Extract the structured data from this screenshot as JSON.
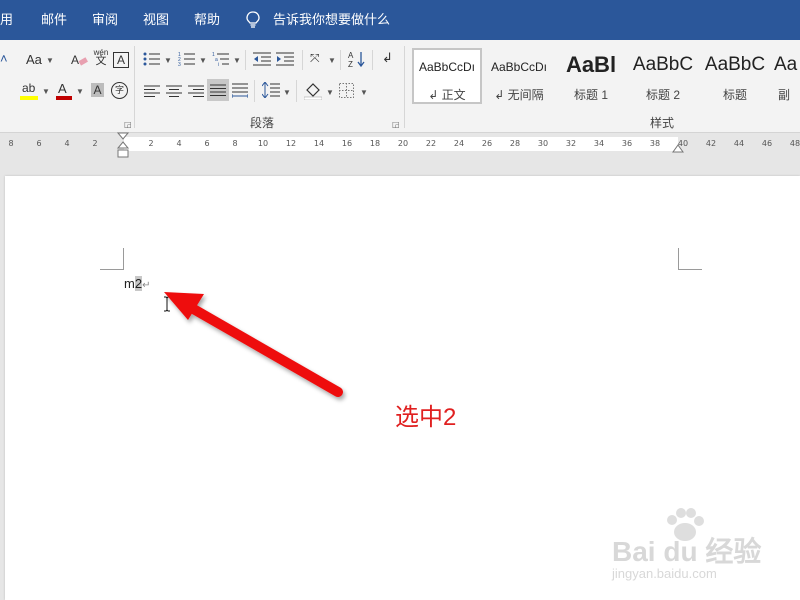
{
  "tabs": {
    "items": [
      "用",
      "邮件",
      "审阅",
      "视图",
      "帮助"
    ],
    "tell_me": "告诉我你想要做什么"
  },
  "ribbon": {
    "font_group": {
      "change_case": "Aa",
      "wen_top": "wén",
      "wen_bottom": "文",
      "char_border": "A",
      "highlight": "ab",
      "font_color": "A",
      "char_shading": "A",
      "enclose_char": "字"
    },
    "paragraph_group": {
      "label": "段落"
    },
    "styles_group": {
      "label": "样式",
      "styles": [
        {
          "preview": "AaBbCcDı",
          "name": "↲ 正文"
        },
        {
          "preview": "AaBbCcDı",
          "name": "↲ 无间隔"
        },
        {
          "preview": "AaBl",
          "name": "标题 1"
        },
        {
          "preview": "AaBbC",
          "name": "标题 2"
        },
        {
          "preview": "AaBbC",
          "name": "标题"
        },
        {
          "preview": "Aa",
          "name": "副"
        }
      ]
    }
  },
  "ruler": {
    "ticks": [
      "8",
      "6",
      "4",
      "2",
      "2",
      "4",
      "6",
      "8",
      "10",
      "12",
      "14",
      "16",
      "18",
      "20",
      "22",
      "24",
      "26",
      "28",
      "30",
      "32",
      "34",
      "36",
      "38",
      "40",
      "42",
      "44",
      "46",
      "48"
    ]
  },
  "document": {
    "text_before": "m",
    "text_selected": "2",
    "paragraph_mark": "↵"
  },
  "annotation": {
    "text": "选中2",
    "color": "#e02020"
  },
  "watermark": {
    "brand": "Bai du 经验",
    "url": "jingyan.baidu.com"
  },
  "colors": {
    "ribbon_blue": "#2b579a",
    "highlight_yellow": "#ffff00",
    "font_red": "#c00000"
  }
}
